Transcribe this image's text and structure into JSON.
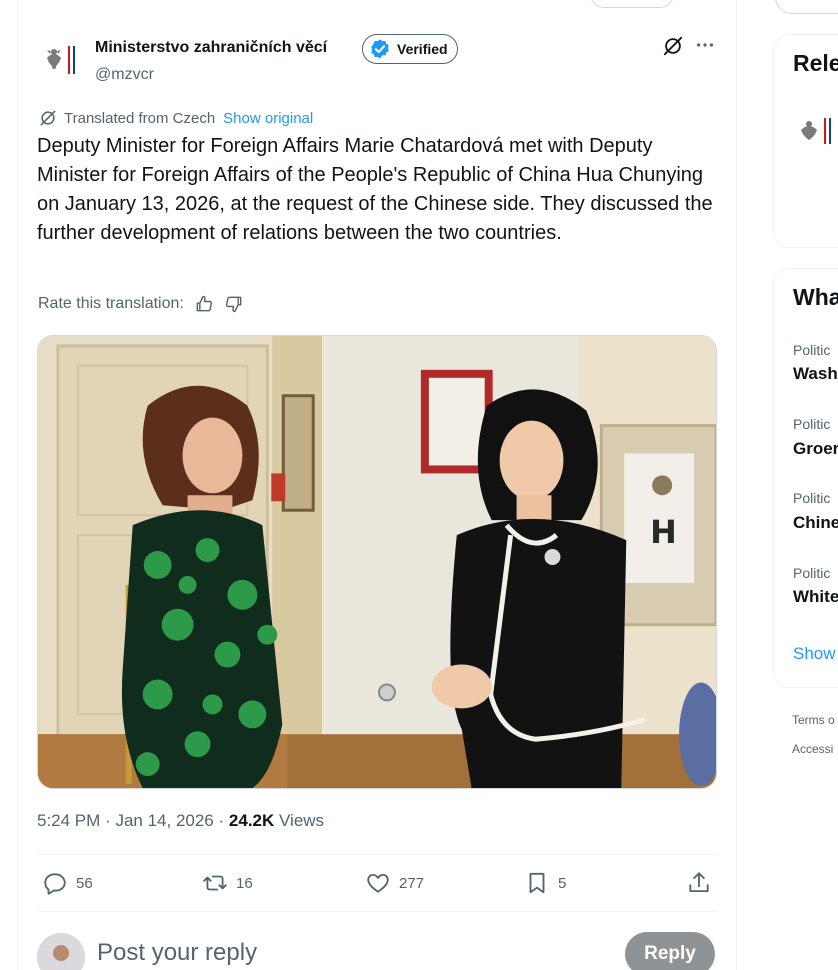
{
  "tweet": {
    "author_name": "Ministerstvo zahraničních věcí",
    "verified_label": "Verified",
    "handle": "@mzvcr",
    "translated_from": "Translated from Czech",
    "show_original": "Show original",
    "text": "Deputy Minister for Foreign Affairs Marie Chatardová met with Deputy Minister for Foreign Affairs of the People's Republic of China Hua Chunying on January 13, 2026, at the request of the Chinese side. They discussed the further development of relations between the two countries.",
    "rate_translation": "Rate this translation:",
    "time": "5:24 PM",
    "date": "Jan 14, 2026",
    "separator": "·",
    "views_count": "24.2K",
    "views_label": "Views",
    "actions": {
      "replies": "56",
      "reposts": "16",
      "likes": "277",
      "bookmarks": "5"
    },
    "reply_placeholder": "Post your reply",
    "reply_button": "Reply"
  },
  "sidebar": {
    "relevant_title": "Rele",
    "happening_title": "Wha",
    "trends": [
      {
        "category": "Politic",
        "name": "Wash"
      },
      {
        "category": "Politic",
        "name": "Groer"
      },
      {
        "category": "Politic",
        "name": "Chine"
      },
      {
        "category": "Politic",
        "name": "White"
      }
    ],
    "show_more": "Show",
    "footer_links": [
      "Terms o",
      "Accessi"
    ]
  },
  "colors": {
    "accent": "#1d9bf0",
    "text_primary": "#0f1419",
    "text_secondary": "#536471",
    "border": "#eff3f4",
    "reply_button_bg": "#8f9396"
  },
  "icons": {
    "verified": "verified-badge-icon",
    "grok": "grok-icon",
    "more": "more-dots-icon",
    "translate": "translate-icon",
    "thumbs_up": "thumbs-up-icon",
    "thumbs_down": "thumbs-down-icon",
    "reply": "reply-bubble-icon",
    "repost": "repost-icon",
    "like": "heart-icon",
    "bookmark": "bookmark-icon",
    "share": "share-icon"
  }
}
